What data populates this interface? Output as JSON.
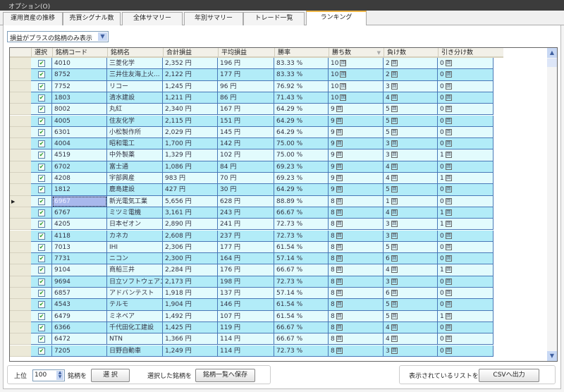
{
  "menu": {
    "options": "オプション(O)"
  },
  "tabs": [
    {
      "label": "運用資産の推移"
    },
    {
      "label": "売買シグナル数"
    },
    {
      "label": "全体サマリー"
    },
    {
      "label": "年別サマリー"
    },
    {
      "label": "トレード一覧"
    },
    {
      "label": "ランキング",
      "active": true
    }
  ],
  "filter": {
    "value": "損益がプラスの銘柄のみ表示"
  },
  "columns": [
    "選択",
    "銘柄コード",
    "銘柄名",
    "合計損益",
    "平均損益",
    "勝率",
    "勝ち数",
    "負け数",
    "引き分け数"
  ],
  "sort_column": "勝ち数",
  "unit_count": "回",
  "colors": {
    "row_light": "#e2fbfd",
    "row_dark": "#b2ecf8",
    "grid_line": "#4878b8",
    "selected_cell": "#a8b8ec"
  },
  "current_row": 12,
  "rows": [
    [
      "4010",
      "三菱化学",
      "2,352 円",
      "196 円",
      "83.33 %",
      "10",
      "2",
      "0"
    ],
    [
      "8752",
      "三井住友海上火...",
      "2,122 円",
      "177 円",
      "83.33 %",
      "10",
      "2",
      "0"
    ],
    [
      "7752",
      "リコー",
      "1,245 円",
      "96 円",
      "76.92 %",
      "10",
      "3",
      "0"
    ],
    [
      "1803",
      "清水建設",
      "1,211 円",
      "86 円",
      "71.43 %",
      "10",
      "4",
      "0"
    ],
    [
      "8002",
      "丸紅",
      "2,340 円",
      "167 円",
      "64.29 %",
      "9",
      "5",
      "0"
    ],
    [
      "4005",
      "住友化学",
      "2,115 円",
      "151 円",
      "64.29 %",
      "9",
      "5",
      "0"
    ],
    [
      "6301",
      "小松製作所",
      "2,029 円",
      "145 円",
      "64.29 %",
      "9",
      "5",
      "0"
    ],
    [
      "4004",
      "昭和電工",
      "1,700 円",
      "142 円",
      "75.00 %",
      "9",
      "3",
      "0"
    ],
    [
      "4519",
      "中外製薬",
      "1,329 円",
      "102 円",
      "75.00 %",
      "9",
      "3",
      "1"
    ],
    [
      "6702",
      "富士通",
      "1,086 円",
      "84 円",
      "69.23 %",
      "9",
      "4",
      "0"
    ],
    [
      "4208",
      "宇部興産",
      "983 円",
      "70 円",
      "69.23 %",
      "9",
      "4",
      "1"
    ],
    [
      "1812",
      "鹿島建設",
      "427 円",
      "30 円",
      "64.29 %",
      "9",
      "5",
      "0"
    ],
    [
      "6967",
      "新光電気工業",
      "5,656 円",
      "628 円",
      "88.89 %",
      "8",
      "1",
      "0"
    ],
    [
      "6767",
      "ミツミ電機",
      "3,161 円",
      "243 円",
      "66.67 %",
      "8",
      "4",
      "1"
    ],
    [
      "4205",
      "日本ゼオン",
      "2,890 円",
      "241 円",
      "72.73 %",
      "8",
      "3",
      "1"
    ],
    [
      "4118",
      "カネカ",
      "2,608 円",
      "237 円",
      "72.73 %",
      "8",
      "3",
      "0"
    ],
    [
      "7013",
      "IHI",
      "2,306 円",
      "177 円",
      "61.54 %",
      "8",
      "5",
      "0"
    ],
    [
      "7731",
      "ニコン",
      "2,300 円",
      "164 円",
      "57.14 %",
      "8",
      "6",
      "0"
    ],
    [
      "9104",
      "商船三井",
      "2,284 円",
      "176 円",
      "66.67 %",
      "8",
      "4",
      "1"
    ],
    [
      "9694",
      "日立ソフトウェアエ...",
      "2,173 円",
      "198 円",
      "72.73 %",
      "8",
      "3",
      "0"
    ],
    [
      "6857",
      "アドバンテスト",
      "1,918 円",
      "137 円",
      "57.14 %",
      "8",
      "6",
      "0"
    ],
    [
      "4543",
      "テルモ",
      "1,904 円",
      "146 円",
      "61.54 %",
      "8",
      "5",
      "0"
    ],
    [
      "6479",
      "ミネベア",
      "1,492 円",
      "107 円",
      "61.54 %",
      "8",
      "5",
      "1"
    ],
    [
      "6366",
      "千代田化工建設",
      "1,425 円",
      "119 円",
      "66.67 %",
      "8",
      "4",
      "0"
    ],
    [
      "6472",
      "NTN",
      "1,366 円",
      "114 円",
      "66.67 %",
      "8",
      "4",
      "0"
    ],
    [
      "7205",
      "日野自動車",
      "1,249 円",
      "114 円",
      "72.73 %",
      "8",
      "3",
      "0"
    ]
  ],
  "bottom": {
    "top_label": "上位",
    "top_value": "100",
    "stocks_label": "銘柄を",
    "select_button": "選 択",
    "selected_label": "選択した銘柄を",
    "save_button": "銘柄一覧へ保存",
    "list_label": "表示されているリストを",
    "csv_button": "CSVへ出力"
  }
}
